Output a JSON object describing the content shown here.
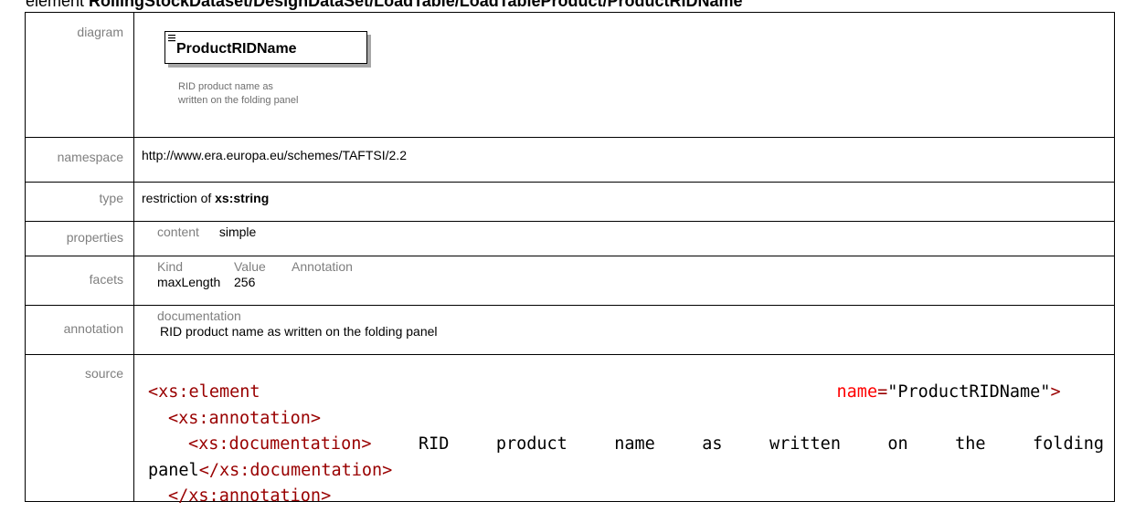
{
  "title": {
    "prefix": "element ",
    "path": "RollingStockDataset/DesignDataSet/LoadTable/LoadTableProduct/ProductRIDName"
  },
  "rows": {
    "diagram_label": "diagram",
    "namespace_label": "namespace",
    "type_label": "type",
    "properties_label": "properties",
    "facets_label": "facets",
    "annotation_label": "annotation",
    "source_label": "source"
  },
  "diagram": {
    "element_name": "ProductRIDName",
    "note_line1": "RID product name as",
    "note_line2": "written on the folding panel"
  },
  "namespace": "http://www.era.europa.eu/schemes/TAFTSI/2.2",
  "type": {
    "prefix": "restriction of ",
    "base": "xs:string"
  },
  "properties": {
    "key": "content",
    "value": "simple"
  },
  "facets": {
    "headers": [
      "Kind",
      "Value",
      "Annotation"
    ],
    "rows": [
      {
        "kind": "maxLength",
        "value": "256",
        "annotation": ""
      }
    ]
  },
  "annotation": {
    "key": "documentation",
    "text": "RID product name as written on the folding panel"
  },
  "source": {
    "l1_tag_open": "<xs:element",
    "l1_attr": "name",
    "l1_eq": "=",
    "l1_value": "\"ProductRIDName\"",
    "l1_close": ">",
    "l2": "<xs:annotation>",
    "l3_tag": "<xs:documentation>",
    "l3_text": " RID product name as written on the folding",
    "l4_text": "panel",
    "l4_tag": "</xs:documentation>",
    "l5": "</xs:annotation>"
  }
}
